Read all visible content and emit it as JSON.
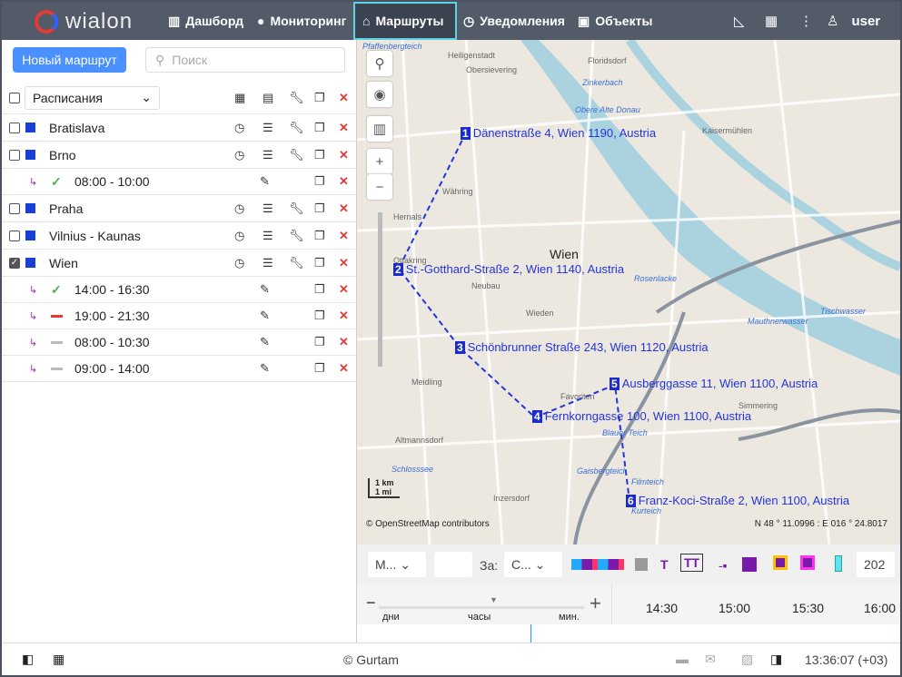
{
  "header": {
    "logo": "wialon",
    "nav": [
      {
        "label": "Дашборд",
        "icon": "chart-icon"
      },
      {
        "label": "Мониторинг",
        "icon": "globe-icon"
      },
      {
        "label": "Маршруты",
        "icon": "map-pin-icon"
      },
      {
        "label": "Уведомления",
        "icon": "alarm-icon"
      },
      {
        "label": "Объекты",
        "icon": "bus-icon"
      }
    ],
    "user": "user"
  },
  "sidebar": {
    "new_route": "Новый маршрут",
    "search_placeholder": "Поиск",
    "filter": "Расписания",
    "routes": [
      {
        "name": "Bratislava",
        "checked": false
      },
      {
        "name": "Brno",
        "checked": false,
        "schedules": [
          {
            "time": "08:00 - 10:00",
            "status": "ok"
          }
        ]
      },
      {
        "name": "Praha",
        "checked": false
      },
      {
        "name": "Vilnius - Kaunas",
        "checked": false
      },
      {
        "name": "Wien",
        "checked": true,
        "schedules": [
          {
            "time": "14:00 - 16:30",
            "status": "ok"
          },
          {
            "time": "19:00 - 21:30",
            "status": "late"
          },
          {
            "time": "08:00 - 10:30",
            "status": "none"
          },
          {
            "time": "09:00 - 14:00",
            "status": "none"
          }
        ]
      }
    ]
  },
  "map": {
    "points": [
      {
        "n": "1",
        "label": "Dänenstraße 4, Wien 1190, Austria"
      },
      {
        "n": "2",
        "label": "St.-Gotthard-Straße 2, Wien 1140, Austria"
      },
      {
        "n": "3",
        "label": "Schönbrunner Straße 243, Wien 1120, Austria"
      },
      {
        "n": "4",
        "label": "Fernkorngasse 100, Wien 1100, Austria"
      },
      {
        "n": "5",
        "label": "Ausberggasse 11, Wien 1100, Austria"
      },
      {
        "n": "6",
        "label": "Franz-Koci-Straße 2, Wien 1100, Austria"
      }
    ],
    "city": "Wien",
    "scale_km": "1 km",
    "scale_mi": "1 mi",
    "attribution": "© OpenStreetMap contributors",
    "coords": "N 48 ° 11.0996 : E 016 ° 24.8017",
    "places": [
      "Pfaffenbergteich",
      "Obersievering",
      "Heiligenstadt",
      "Floridsdorf",
      "Zinkerbach",
      "Obere Alte Donau",
      "Kaisermühlen",
      "Währing",
      "Hernals",
      "Ottakring",
      "Neubau",
      "Wieden",
      "Favoriten",
      "Meidling",
      "Simmering",
      "Rosenlacke",
      "Altmannsdorf",
      "Inzersdorf",
      "Blauer Teich",
      "Filmteich",
      "Kurteich",
      "Schlosssee",
      "Gaisbergteich",
      "Mauthnerwasser",
      "Tischwasser"
    ]
  },
  "timeline": {
    "sel1": "М...",
    "za": "За:",
    "sel2": "С...",
    "num": "202",
    "scale_labels": [
      "дни",
      "часы",
      "мин."
    ],
    "ticks": [
      "14:30",
      "15:00",
      "15:30",
      "16:00"
    ]
  },
  "footer": {
    "copyright": "© Gurtam",
    "time": "13:36:07 (+03)"
  }
}
